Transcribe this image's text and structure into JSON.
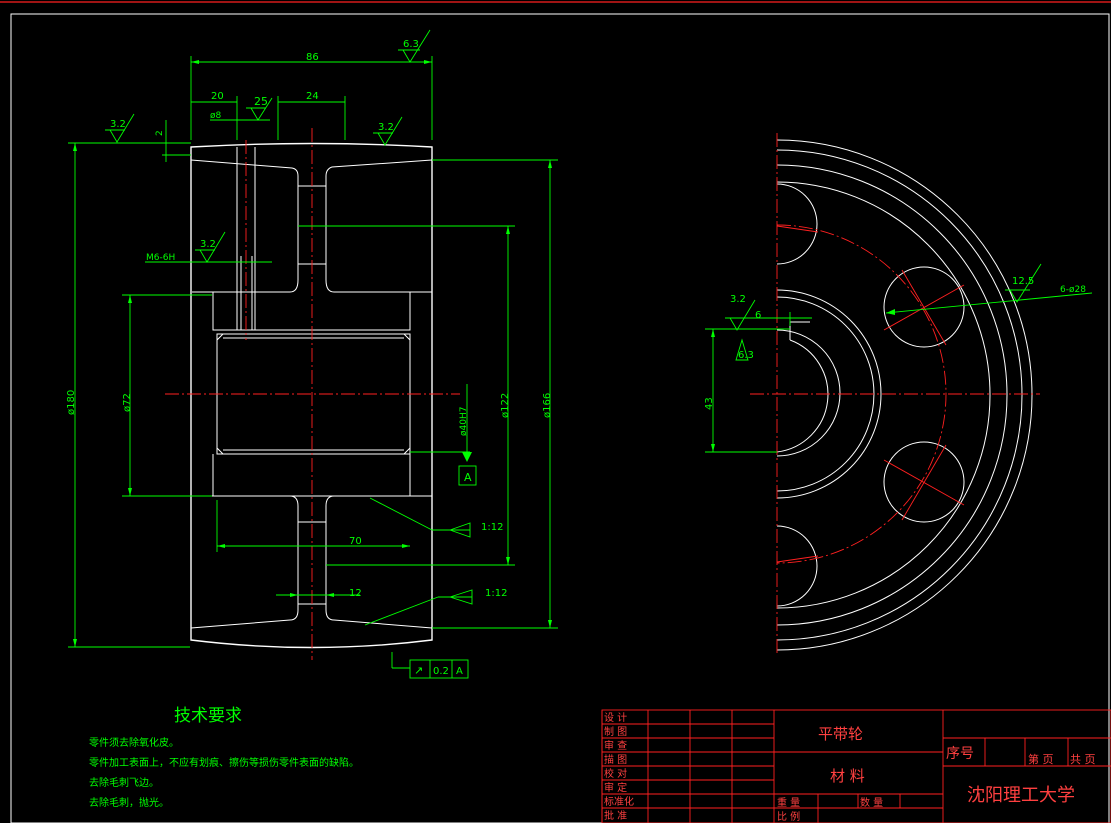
{
  "dimensions": {
    "d86": "86",
    "d20": "20",
    "d25": "25",
    "d24": "24",
    "phi8": "ø8",
    "d2": "2",
    "m6": "M6-6H",
    "phi180": "ø180",
    "phi72": "ø72",
    "phi40": "ø40H7",
    "phi122": "ø122",
    "phi166": "ø166",
    "d70": "70",
    "d12": "12",
    "d43": "43",
    "d6": "6",
    "holes": "6-ø28"
  },
  "roughness": {
    "r63a": "6.3",
    "r32a": "3.2",
    "r32b": "3.2",
    "r32c": "3.2",
    "r32d": "3.2",
    "r63b": "6.3",
    "r125": "12.5"
  },
  "tapers": {
    "t1": "1:12",
    "t2": "1:12"
  },
  "datum": {
    "label": "A",
    "tolerance": "0.2",
    "ref": "A",
    "symbol": "↗"
  },
  "notes": {
    "title": "技术要求",
    "items": [
      "零件须去除氧化皮。",
      "零件加工表面上，不应有划痕、擦伤等损伤零件表面的缺陷。",
      "去除毛刺飞边。",
      "去除毛刺，抛光。"
    ]
  },
  "title_block": {
    "left_labels": [
      "设 计",
      "制 图",
      "审 查",
      "描 图",
      "校 对",
      "审 定",
      "标准化",
      "批 准"
    ],
    "part_name": "平带轮",
    "material": "材 料",
    "weight": "重 量",
    "quantity": "数 量",
    "scale": "比 例",
    "seq": "序号",
    "page": "第 页",
    "total": "共 页",
    "school": "沈阳理工大学"
  }
}
